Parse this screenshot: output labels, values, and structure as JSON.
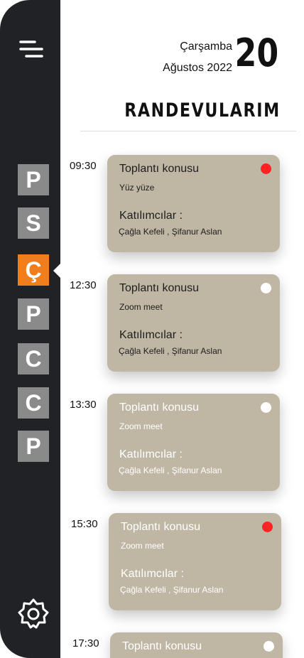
{
  "sidebar": {
    "days": [
      {
        "letter": "P"
      },
      {
        "letter": "S"
      },
      {
        "letter": "Ç"
      },
      {
        "letter": "P"
      },
      {
        "letter": "C"
      },
      {
        "letter": "C"
      },
      {
        "letter": "P"
      }
    ],
    "active_index": 2,
    "active_color": "#f07e1c",
    "menu_icon": "menu-icon",
    "settings_icon": "gear-icon"
  },
  "header": {
    "weekday": "Çarşamba",
    "month_year": "Ağustos 2022",
    "day": "20",
    "title": "RANDEVULARIM"
  },
  "appointments": [
    {
      "time": "09:30",
      "title": "Toplantı konusu",
      "mode": "Yüz yüze",
      "participants_label": "Katılımcılar :",
      "participants": "Çağla Kefeli , Şifanur Aslan",
      "status_color": "#ff2323"
    },
    {
      "time": "12:30",
      "title": "Toplantı konusu",
      "mode": "Zoom meet",
      "participants_label": "Katılımcılar :",
      "participants": "Çağla Kefeli , Şifanur Aslan",
      "status_color": "#ffffff"
    },
    {
      "time": "13:30",
      "title": "Toplantı konusu",
      "mode": "Zoom meet",
      "participants_label": "Katılımcılar :",
      "participants": "Çağla Kefeli , Şifanur Aslan",
      "status_color": "#ffffff"
    },
    {
      "time": "15:30",
      "title": "Toplantı konusu",
      "mode": "Zoom meet",
      "participants_label": "Katılımcılar :",
      "participants": "Çağla Kefeli , Şifanur Aslan",
      "status_color": "#ff2323"
    },
    {
      "time": "17:30",
      "title": "Toplantı konusu",
      "mode": "",
      "participants_label": "",
      "participants": "",
      "status_color": "#ffffff"
    }
  ],
  "colors": {
    "sidebar_bg": "#212226",
    "card_bg": "#bfb7a4",
    "tile_bg": "#8a8a8a"
  }
}
